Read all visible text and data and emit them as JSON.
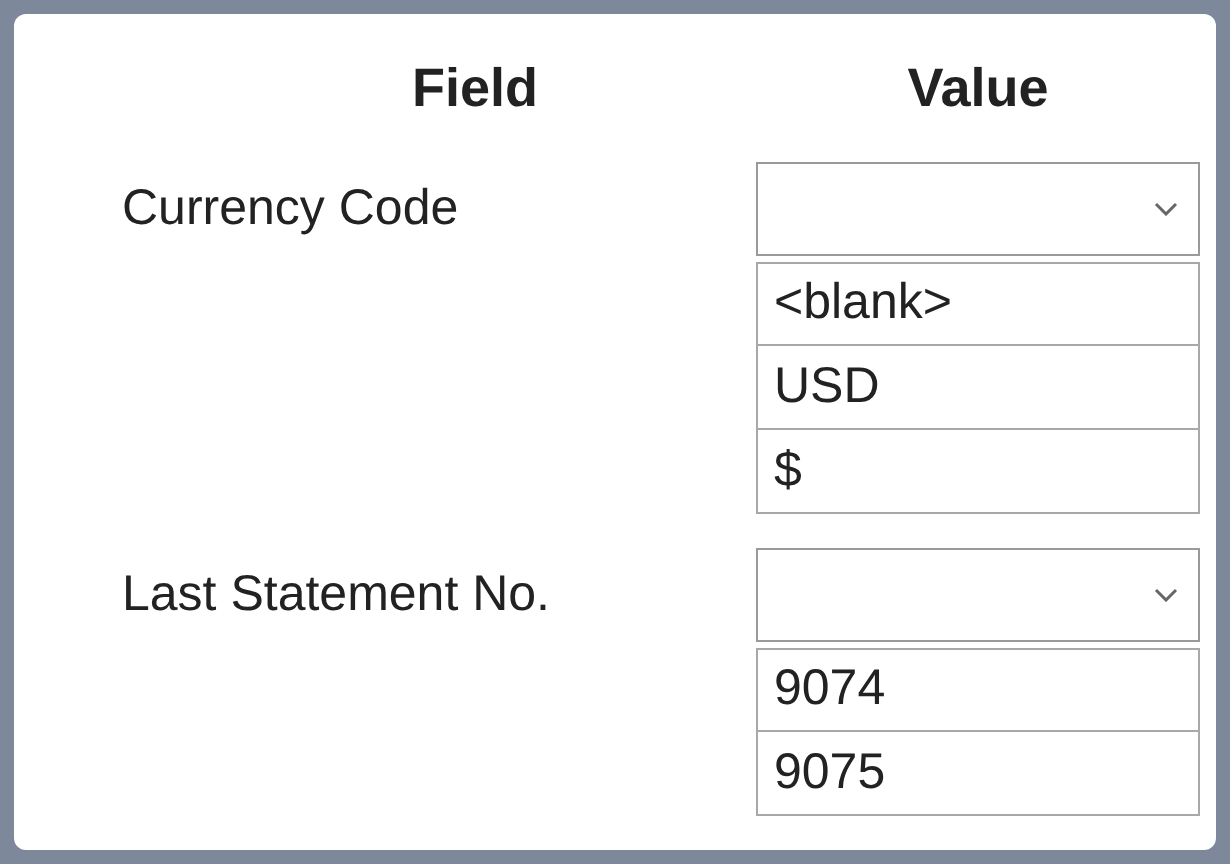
{
  "header": {
    "column_1": "Field",
    "column_2": "Value"
  },
  "rows": [
    {
      "label": "Currency Code",
      "dropdown": {
        "expanded": true,
        "options": [
          "<blank>",
          "USD",
          "$"
        ]
      }
    },
    {
      "label": "Last Statement No.",
      "dropdown": {
        "expanded": true,
        "options": [
          "9074",
          "9075"
        ]
      }
    }
  ]
}
